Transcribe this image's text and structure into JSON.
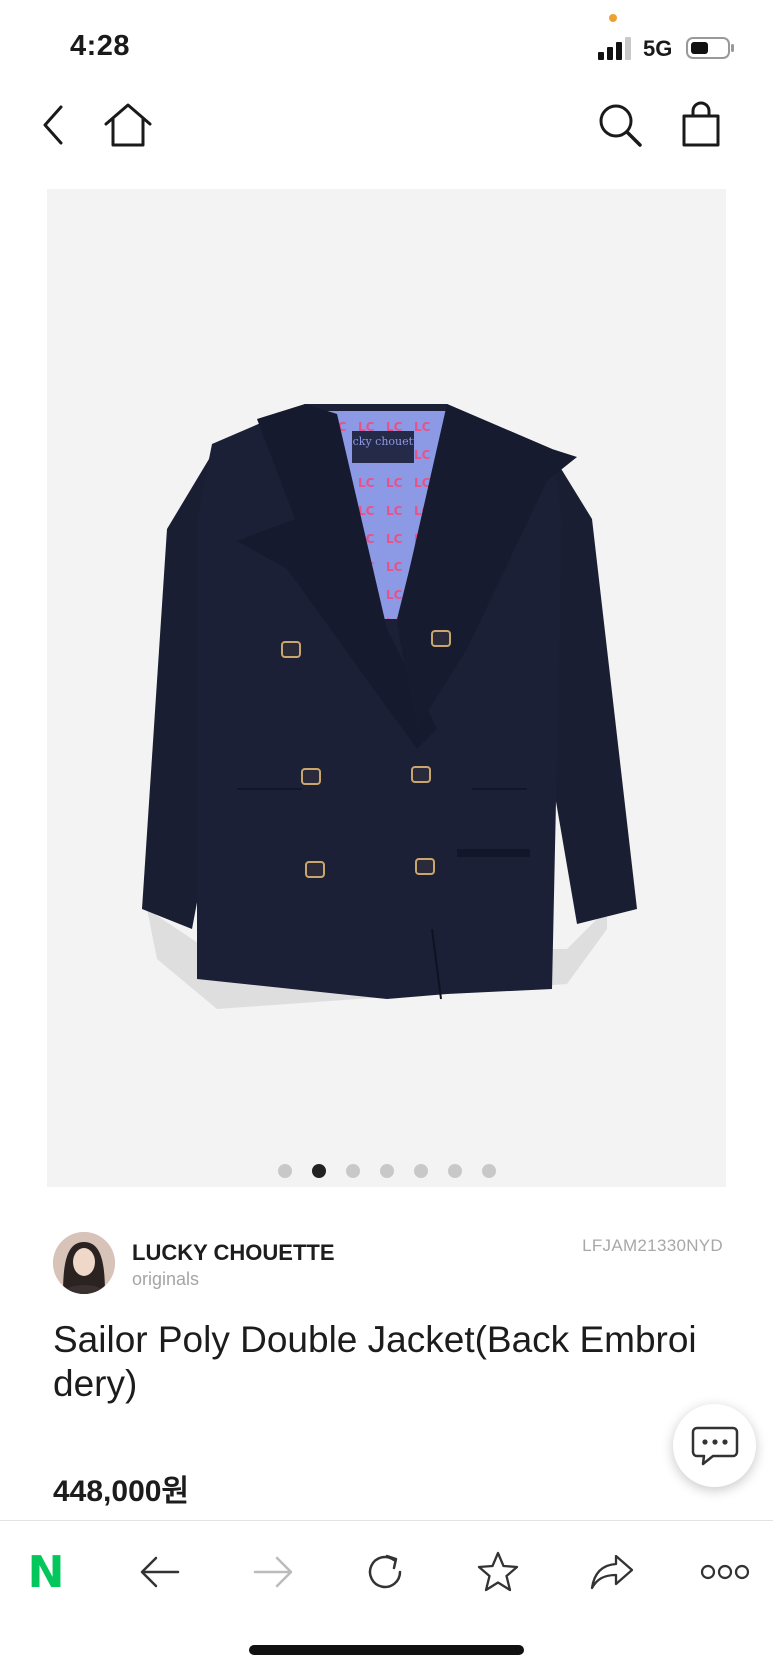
{
  "status_bar": {
    "time": "4:28",
    "network": "5G",
    "signal_icon": "cellular-signal-icon",
    "battery_icon": "battery-icon"
  },
  "nav": {
    "back_icon": "chevron-left-icon",
    "home_icon": "home-icon",
    "search_icon": "search-icon",
    "cart_icon": "shopping-bag-icon"
  },
  "gallery": {
    "slide_count": 7,
    "active_index": 1,
    "label_text": "lucky chouette"
  },
  "brand": {
    "name": "LUCKY CHOUETTE",
    "subtitle": "originals",
    "sku": "LFJAM21330NYD"
  },
  "product": {
    "title": "Sailor Poly Double Jacket(Back Embroidery)",
    "price": "448,000원"
  },
  "chat": {
    "icon": "chat-bubble-icon"
  },
  "toolbar": {
    "logo": "N",
    "items": [
      "back-arrow-icon",
      "forward-arrow-icon",
      "reload-icon",
      "star-icon",
      "share-icon",
      "more-icon"
    ]
  },
  "colors": {
    "naver_green": "#03c75a",
    "jacket_navy": "#1a1e33",
    "lining_blue": "#8c9ae6",
    "lining_pink": "#e8518a",
    "active_dot": "#222222",
    "inactive_dot": "#c8c8c8"
  }
}
